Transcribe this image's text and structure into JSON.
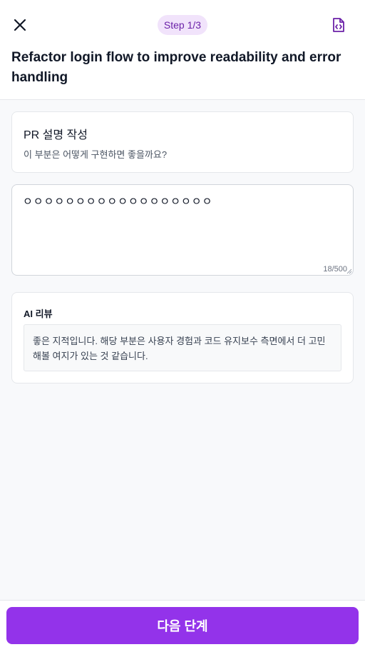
{
  "header": {
    "close_icon": "close-icon",
    "step_label": "Step 1/3",
    "action_icon": "file-code-icon",
    "title": "Refactor login flow to improve readability and error handling"
  },
  "question": {
    "title": "PR 설명 작성",
    "subtitle": "이 부분은 어떻게 구현하면 좋을까요?"
  },
  "answer": {
    "value": "ㅇㅇㅇㅇㅇㅇㅇㅇㅇㅇㅇㅇㅇㅇㅇㅇㅇㅇ",
    "counter": "18/500"
  },
  "review": {
    "title": "AI 리뷰",
    "body": "좋은 지적입니다. 해당 부분은 사용자 경험과 코드 유지보수 측면에서 더 고민해볼 여지가 있는 것 같습니다."
  },
  "footer": {
    "next_label": "다음 단계"
  },
  "colors": {
    "accent": "#9333ea",
    "badge_bg": "#f1e3fb",
    "badge_text": "#6b21a8",
    "background": "#f8f9fb"
  }
}
